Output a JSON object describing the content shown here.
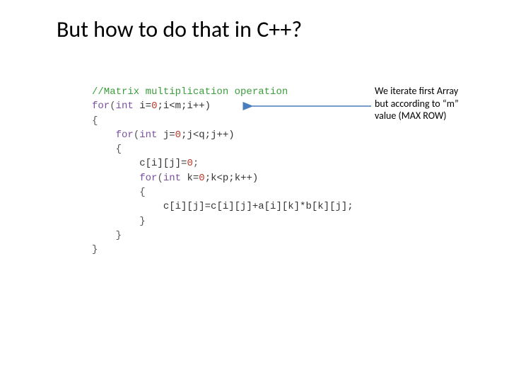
{
  "title": "But how to do that in C++?",
  "annotation": {
    "line1": "We iterate first Array",
    "line2": "but according to “m”",
    "line3": "value (MAX ROW)"
  },
  "code": {
    "comment": "//Matrix multiplication operation",
    "for_kw": "for",
    "int_kw": "int",
    "loop1_a": " i=",
    "zero": "0",
    "loop1_b": ";i<m;i++)",
    "brace_open": "{",
    "brace_close": "}",
    "loop2_a": " j=",
    "loop2_b": ";j<q;j++)",
    "stmt1": "c[i][j]=",
    "semi": ";",
    "loop3_a": " k=",
    "loop3_b": ";k<p;k++)",
    "stmt2": "c[i][j]=c[i][j]+a[i][k]*b[k][j];"
  }
}
